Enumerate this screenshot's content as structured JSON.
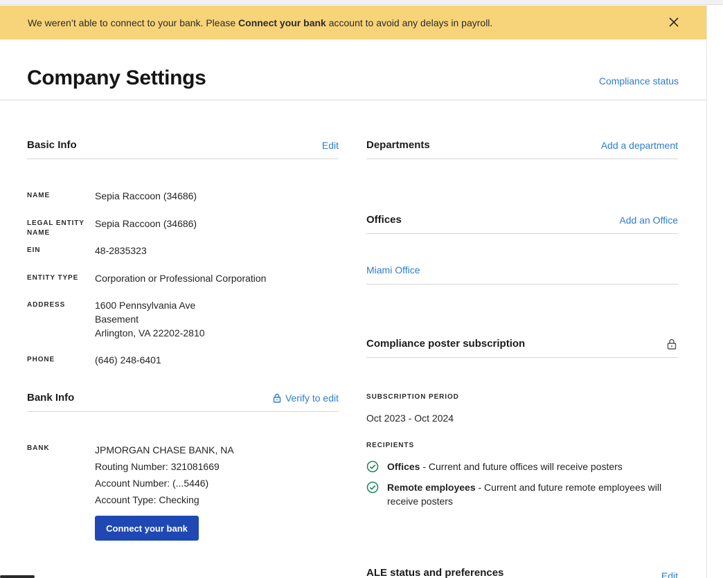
{
  "banner": {
    "text_before": "We weren’t able to connect to your bank. Please",
    "bold": "Connect your bank",
    "text_after": "account to avoid any delays in payroll."
  },
  "header": {
    "title": "Company Settings",
    "compliance_link": "Compliance status"
  },
  "basic_info": {
    "heading": "Basic Info",
    "edit": "Edit",
    "fields": {
      "name_label": "NAME",
      "name_value": "Sepia Raccoon (34686)",
      "legal_label_1": "LEGAL ENTITY",
      "legal_label_2": "NAME",
      "legal_value": "Sepia Raccoon (34686)",
      "ein_label": "EIN",
      "ein_value": "48-2835323",
      "entity_label": "ENTITY TYPE",
      "entity_value": "Corporation or Professional Corporation",
      "address_label": "ADDRESS",
      "address_line1": "1600 Pennsylvania Ave",
      "address_line2": "Basement",
      "address_line3": "Arlington, VA 22202-2810",
      "phone_label": "PHONE",
      "phone_value": "(646) 248-6401"
    }
  },
  "bank_info": {
    "heading": "Bank Info",
    "verify": "Verify to edit",
    "bank_label": "BANK",
    "bank_name": "JPMORGAN CHASE BANK, NA",
    "routing": "Routing Number: 321081669",
    "account": "Account Number: (...5446)",
    "account_type": "Account Type: Checking",
    "connect_button": "Connect your bank"
  },
  "departments": {
    "heading": "Departments",
    "add": "Add a department"
  },
  "offices": {
    "heading": "Offices",
    "add": "Add an Office",
    "items": [
      "Miami Office"
    ]
  },
  "poster": {
    "heading": "Compliance poster subscription",
    "period_label": "SUBSCRIPTION PERIOD",
    "period_value": "Oct 2023 - Oct 2024",
    "recipients_label": "RECIPIENTS",
    "recipients": [
      {
        "bold": "Offices",
        "text": " - Current and future offices will receive posters"
      },
      {
        "bold": "Remote employees",
        "text": " - Current and future remote employees will receive posters"
      }
    ]
  },
  "ale": {
    "heading": "ALE status and preferences",
    "edit": "Edit"
  },
  "colors": {
    "banner": "#f7d479",
    "link": "#2d7cd0",
    "primary_button": "#1f48b5",
    "check": "#1e8a5a"
  },
  "icons": [
    "close-icon",
    "lock-icon",
    "check-circle-icon"
  ]
}
